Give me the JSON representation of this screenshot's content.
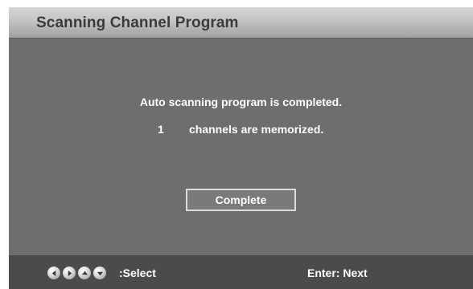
{
  "header": {
    "title": "Scanning Channel Program"
  },
  "dialog": {
    "message": "Auto scanning program is completed.",
    "count": "1",
    "count_text": "channels are memorized.",
    "button_label": "Complete"
  },
  "footer": {
    "nav_icons": [
      "left-arrow-icon",
      "right-arrow-icon",
      "up-arrow-icon",
      "down-arrow-icon"
    ],
    "select_label": ":Select",
    "enter_label": "Enter: Next"
  },
  "colors": {
    "background": "#6e6e6e",
    "header": "#c3c3c3",
    "footer": "#4b4b4b",
    "text": "#ffffff",
    "title_text": "#3b3b3b"
  }
}
